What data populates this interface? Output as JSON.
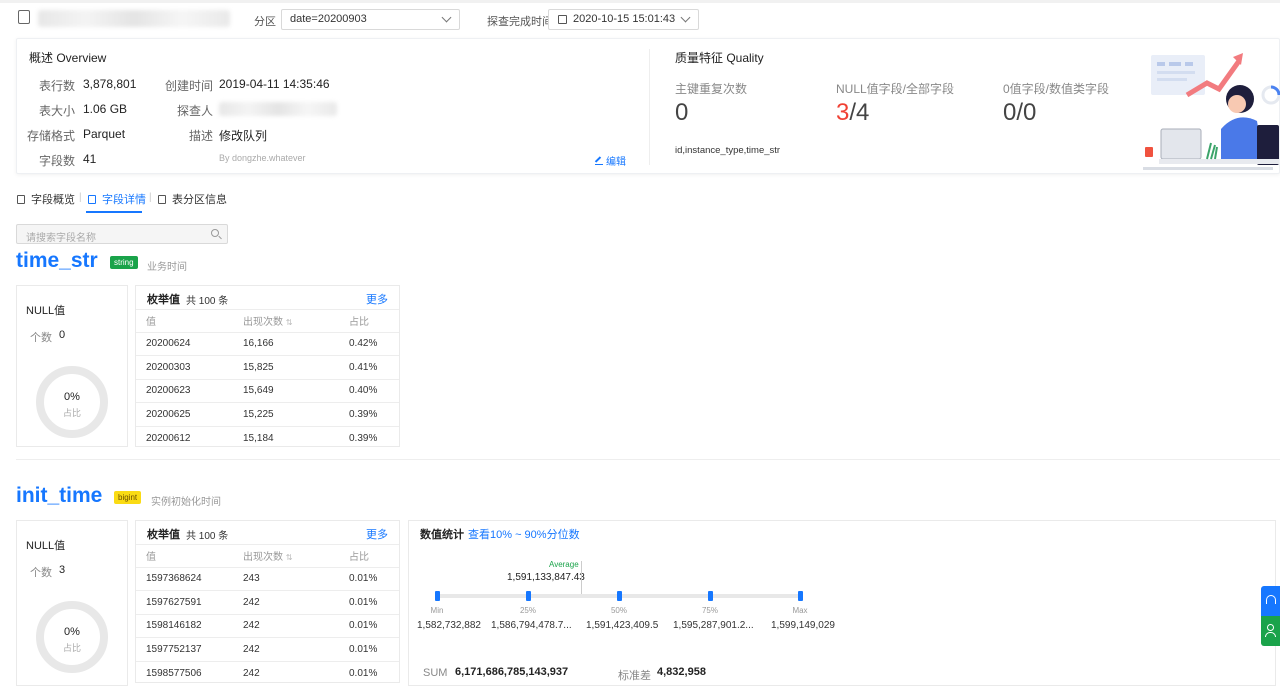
{
  "header": {
    "partition_label": "分区",
    "partition_value": "date=20200903",
    "probe_time_label": "探查完成时间",
    "probe_time_value": "2020-10-15 15:01:43"
  },
  "overview": {
    "title": "概述 Overview",
    "row_count_label": "表行数",
    "row_count": "3,878,801",
    "size_label": "表大小",
    "size": "1.06 GB",
    "format_label": "存储格式",
    "format": "Parquet",
    "field_count_label": "字段数",
    "field_count": "41",
    "created_label": "创建时间",
    "created": "2019-04-11 14:35:46",
    "prober_label": "探查人",
    "desc_label": "描述",
    "desc": "修改队列",
    "by": "By dongzhe.whatever",
    "edit": "编辑"
  },
  "quality": {
    "title": "质量特征 Quality",
    "pk_dup_label": "主键重复次数",
    "pk_dup": "0",
    "null_label": "NULL值字段/全部字段",
    "null_num": "3",
    "null_den": "/4",
    "zero_label": "0值字段/数值类字段",
    "zero": "0/0",
    "keys": "id,instance_type,time_str"
  },
  "tabs": [
    {
      "label": "字段概览"
    },
    {
      "label": "字段详情"
    },
    {
      "label": "表分区信息"
    }
  ],
  "search": {
    "placeholder": "请搜索字段名称"
  },
  "fields": [
    {
      "name": "time_str",
      "type": "string",
      "desc": "业务时间",
      "null_title": "NULL值",
      "count_label": "个数",
      "count": "0",
      "pct": "0%",
      "pct_label": "占比",
      "enum_title": "枚举值",
      "enum_total": "共 100 条",
      "more": "更多",
      "cols": [
        "值",
        "出现次数",
        "占比"
      ],
      "rows": [
        [
          "20200624",
          "16,166",
          "0.42%"
        ],
        [
          "20200303",
          "15,825",
          "0.41%"
        ],
        [
          "20200623",
          "15,649",
          "0.40%"
        ],
        [
          "20200625",
          "15,225",
          "0.39%"
        ],
        [
          "20200612",
          "15,184",
          "0.39%"
        ]
      ]
    },
    {
      "name": "init_time",
      "type": "bigint",
      "desc": "实例初始化时间",
      "null_title": "NULL值",
      "count_label": "个数",
      "count": "3",
      "pct": "0%",
      "pct_label": "占比",
      "enum_title": "枚举值",
      "enum_total": "共 100 条",
      "more": "更多",
      "cols": [
        "值",
        "出现次数",
        "占比"
      ],
      "rows": [
        [
          "1597368624",
          "243",
          "0.01%"
        ],
        [
          "1597627591",
          "242",
          "0.01%"
        ],
        [
          "1598146182",
          "242",
          "0.01%"
        ],
        [
          "1597752137",
          "242",
          "0.01%"
        ],
        [
          "1598577506",
          "242",
          "0.01%"
        ]
      ],
      "stats": {
        "title": "数值统计",
        "link": "查看10% ~ 90%分位数",
        "avg_label": "Average",
        "avg": "1,591,133,847.43",
        "quantiles": [
          {
            "label": "Min",
            "value": "1,582,732,882"
          },
          {
            "label": "25%",
            "value": "1,586,794,478.7..."
          },
          {
            "label": "50%",
            "value": "1,591,423,409.5"
          },
          {
            "label": "75%",
            "value": "1,595,287,901.2..."
          },
          {
            "label": "Max",
            "value": "1,599,149,029"
          }
        ],
        "sum_label": "SUM",
        "sum": "6,171,686,785,143,937",
        "std_label": "标准差",
        "std": "4,832,958"
      }
    }
  ],
  "colors": {
    "accent": "#1677ff",
    "string_badge": "#1aa34a",
    "bigint_badge": "#fadb14",
    "null_red": "#f04134"
  },
  "icons": [
    "file-icon",
    "calendar-icon",
    "edit-icon",
    "search-icon",
    "headset-icon",
    "user-icon"
  ]
}
